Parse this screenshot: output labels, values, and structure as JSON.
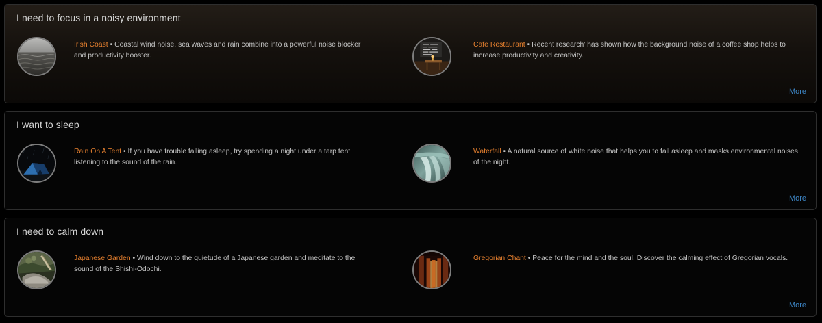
{
  "sections": [
    {
      "title": "I need to focus in a noisy environment",
      "more_label": "More",
      "items": [
        {
          "name": "Irish Coast",
          "separator": " • ",
          "description": "Coastal wind noise, sea waves and rain combine into a powerful noise blocker and productivity booster.",
          "image": "sea-waves-thumbnail"
        },
        {
          "name": "Cafe Restaurant",
          "separator": " • ",
          "description": "Recent research’ has shown how the background noise of a coffee shop helps to increase productivity and creativity.",
          "image": "cafe-interior-thumbnail"
        }
      ]
    },
    {
      "title": "I want to sleep",
      "more_label": "More",
      "items": [
        {
          "name": "Rain On A Tent",
          "separator": " • ",
          "description": "If you have trouble falling asleep, try spending a night under a tarp tent listening to the sound of the rain.",
          "image": "tent-at-night-thumbnail"
        },
        {
          "name": "Waterfall",
          "separator": " • ",
          "description": "A natural source of white noise that helps you to fall asleep and masks environmental noises of the night.",
          "image": "waterfall-thumbnail"
        }
      ]
    },
    {
      "title": "I need to calm down",
      "more_label": "More",
      "items": [
        {
          "name": "Japanese Garden",
          "separator": " • ",
          "description": "Wind down to the quietude of a Japanese garden and meditate to the sound of the Shishi-Odochi.",
          "image": "japanese-garden-thumbnail"
        },
        {
          "name": "Gregorian Chant",
          "separator": " • ",
          "description": "Peace for the mind and the soul. Discover the calming effect of Gregorian vocals.",
          "image": "cloister-corridor-thumbnail"
        }
      ]
    }
  ],
  "colors": {
    "background": "#000000",
    "item_title": "#e8812f",
    "link": "#3d86c6",
    "text": "#c4c4c4",
    "heading": "#d6d6d6"
  }
}
